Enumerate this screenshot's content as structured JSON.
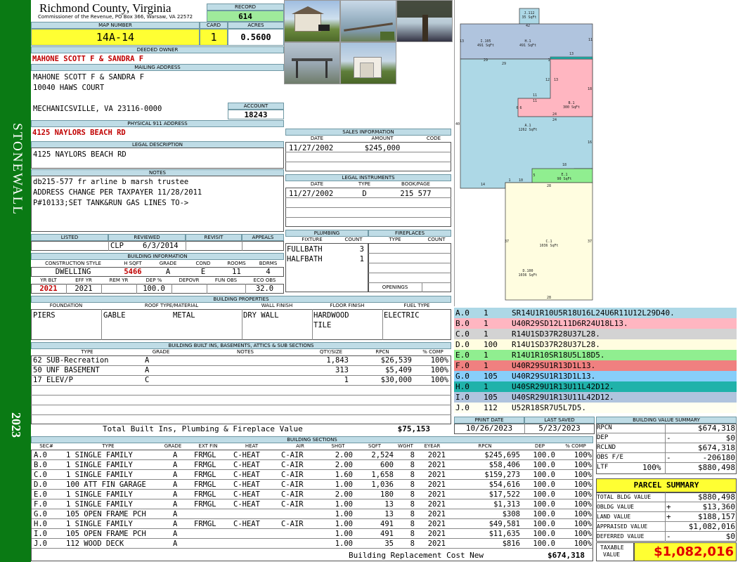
{
  "district": "STONEWALL",
  "year": "2023",
  "header": {
    "county": "Richmond County, Virginia",
    "commissioner": "Commissioner of the Revenue, PO Box 366, Warsaw, VA 22572",
    "record_label": "RECORD",
    "record": "614",
    "map_number_label": "MAP NUMBER",
    "map_number": "14A-14",
    "card_label": "CARD",
    "card": "1",
    "acres_label": "ACRES",
    "acres": "0.5600"
  },
  "owner": {
    "deeded_label": "DEEDED OWNER",
    "deeded_owner": "MAHONE SCOTT F & SANDRA F",
    "mailing_label": "MAILING ADDRESS",
    "mailing_line1": "MAHONE SCOTT F & SANDRA F",
    "mailing_line2": "10040 HAWS COURT",
    "mailing_line3": "MECHANICSVILLE, VA 23116-0000",
    "account_label": "ACCOUNT",
    "account": "18243",
    "physical_label": "PHYSICAL 911 ADDRESS",
    "physical_address": "4125 NAYLORS BEACH RD",
    "legal_label": "LEGAL DESCRIPTION",
    "legal_description": "4125 NAYLORS BEACH RD",
    "notes_label": "NOTES",
    "notes": [
      "db215-577 fr arline b marsh trustee",
      "ADDRESS CHANGE PER TAXPAYER 11/28/2011",
      "P#10133;SET TANK&RUN GAS LINES TO->"
    ]
  },
  "review": {
    "listed_label": "LISTED",
    "reviewed_label": "REVIEWED",
    "revisit_label": "REVISIT",
    "appeals_label": "APPEALS",
    "listed": "",
    "reviewed_by": "CLP",
    "reviewed_date": "6/3/2014",
    "revisit": "",
    "appeals": ""
  },
  "building_info": {
    "title": "BUILDING INFORMATION",
    "labels": [
      "CONSTRUCTION STYLE",
      "H SQFT",
      "GRADE",
      "COND",
      "ROOMS",
      "BDRMS"
    ],
    "style": "DWELLING",
    "hsqft": "5466",
    "grade": "A",
    "cond": "E",
    "rooms": "11",
    "bdrms": "4",
    "labels2": [
      "YR BLT",
      "EFF YR",
      "REM YR",
      "DEP %",
      "DEPOVR",
      "FUN OBS",
      "ECO OBS"
    ],
    "yr_blt": "2021",
    "eff_yr": "2021",
    "rem_yr": "",
    "dep_pct": "100.0",
    "depovr": "",
    "fun_obs": "",
    "eco_obs": "32.0"
  },
  "sales": {
    "title": "SALES INFORMATION",
    "headers": [
      "DATE",
      "AMOUNT",
      "CODE"
    ],
    "rows": [
      {
        "date": "11/27/2002",
        "amount": "$245,000",
        "code": ""
      }
    ]
  },
  "legal_instruments": {
    "title": "LEGAL INSTRUMENTS",
    "headers": [
      "DATE",
      "TYPE",
      "BOOK/PAGE"
    ],
    "rows": [
      {
        "date": "11/27/2002",
        "type": "D",
        "bookpage": "215 577"
      }
    ]
  },
  "plumbing": {
    "title": "PLUMBING",
    "headers": [
      "FIXTURE",
      "COUNT"
    ],
    "rows": [
      {
        "fixture": "FULLBATH",
        "count": "3"
      },
      {
        "fixture": "HALFBATH",
        "count": "1"
      }
    ]
  },
  "fireplaces": {
    "title": "FIREPLACES",
    "headers": [
      "TYPE",
      "COUNT"
    ],
    "openings_label": "OPENINGS"
  },
  "properties": {
    "title": "BUILDING PROPERTIES",
    "headers": [
      "FOUNDATION",
      "ROOF TYPE/MATERIAL",
      "WALL FINISH",
      "FLOOR FINISH",
      "FUEL TYPE"
    ],
    "foundation": "PIERS",
    "roof_type": "GABLE",
    "roof_material": "METAL",
    "wall_finish": "DRY WALL",
    "floor_finish_1": "HARDWOOD",
    "floor_finish_2": "TILE",
    "fuel_type": "ELECTRIC"
  },
  "built_ins": {
    "title": "BUILDING BUILT INS, BASEMENTS, ATTICS & SUB SECTIONS",
    "headers": [
      "TYPE",
      "GRADE",
      "NOTES",
      "QTY/SIZE",
      "RPCN",
      "% COMP"
    ],
    "rows": [
      {
        "type": "62 SUB-Recreation",
        "grade": "A",
        "notes": "",
        "qty": "1,843",
        "rpcn": "$26,539",
        "comp": "100%"
      },
      {
        "type": "50 UNF BASEMENT",
        "grade": "A",
        "notes": "",
        "qty": "313",
        "rpcn": "$5,409",
        "comp": "100%"
      },
      {
        "type": "17 ELEV/P",
        "grade": "C",
        "notes": "",
        "qty": "1",
        "rpcn": "$30,000",
        "comp": "100%"
      }
    ],
    "total_label": "Total Built Ins, Plumbing & Fireplace Value",
    "total": "$75,153"
  },
  "print": {
    "print_label": "PRINT DATE",
    "print_date": "10/26/2023",
    "saved_label": "LAST SAVED",
    "last_saved": "5/23/2023"
  },
  "sections": {
    "title": "BUILDING SECTIONS",
    "headers": [
      "SEC#",
      "TYPE",
      "GRADE",
      "EXT FIN",
      "HEAT",
      "AIR",
      "SHGT",
      "SQFT",
      "WGHT",
      "EYEAR",
      "RPCN",
      "DEP",
      "% COMP"
    ],
    "rows": [
      {
        "sec": "A.0",
        "type": "1 SINGLE FAMILY",
        "grade": "A",
        "ext": "FRMGL",
        "heat": "C-HEAT",
        "air": "C-AIR",
        "shgt": "2.00",
        "sqft": "2,524",
        "wght": "8",
        "eyear": "2021",
        "rpcn": "$245,695",
        "dep": "100.0",
        "comp": "100%"
      },
      {
        "sec": "B.0",
        "type": "1 SINGLE FAMILY",
        "grade": "A",
        "ext": "FRMGL",
        "heat": "C-HEAT",
        "air": "C-AIR",
        "shgt": "2.00",
        "sqft": "600",
        "wght": "8",
        "eyear": "2021",
        "rpcn": "$58,406",
        "dep": "100.0",
        "comp": "100%"
      },
      {
        "sec": "C.0",
        "type": "1 SINGLE FAMILY",
        "grade": "A",
        "ext": "FRMGL",
        "heat": "C-HEAT",
        "air": "C-AIR",
        "shgt": "1.60",
        "sqft": "1,658",
        "wght": "8",
        "eyear": "2021",
        "rpcn": "$159,273",
        "dep": "100.0",
        "comp": "100%"
      },
      {
        "sec": "D.0",
        "type": "100 ATT FIN GARAGE",
        "grade": "A",
        "ext": "FRMGL",
        "heat": "C-HEAT",
        "air": "C-AIR",
        "shgt": "1.00",
        "sqft": "1,036",
        "wght": "8",
        "eyear": "2021",
        "rpcn": "$54,616",
        "dep": "100.0",
        "comp": "100%"
      },
      {
        "sec": "E.0",
        "type": "1 SINGLE FAMILY",
        "grade": "A",
        "ext": "FRMGL",
        "heat": "C-HEAT",
        "air": "C-AIR",
        "shgt": "2.00",
        "sqft": "180",
        "wght": "8",
        "eyear": "2021",
        "rpcn": "$17,522",
        "dep": "100.0",
        "comp": "100%"
      },
      {
        "sec": "F.0",
        "type": "1 SINGLE FAMILY",
        "grade": "A",
        "ext": "FRMGL",
        "heat": "C-HEAT",
        "air": "C-AIR",
        "shgt": "1.00",
        "sqft": "13",
        "wght": "8",
        "eyear": "2021",
        "rpcn": "$1,313",
        "dep": "100.0",
        "comp": "100%"
      },
      {
        "sec": "G.0",
        "type": "105 OPEN FRAME PCH",
        "grade": "A",
        "ext": "",
        "heat": "",
        "air": "",
        "shgt": "1.00",
        "sqft": "13",
        "wght": "8",
        "eyear": "2021",
        "rpcn": "$308",
        "dep": "100.0",
        "comp": "100%"
      },
      {
        "sec": "H.0",
        "type": "1 SINGLE FAMILY",
        "grade": "A",
        "ext": "FRMGL",
        "heat": "C-HEAT",
        "air": "C-AIR",
        "shgt": "1.00",
        "sqft": "491",
        "wght": "8",
        "eyear": "2021",
        "rpcn": "$49,581",
        "dep": "100.0",
        "comp": "100%"
      },
      {
        "sec": "I.0",
        "type": "105 OPEN FRAME PCH",
        "grade": "A",
        "ext": "",
        "heat": "",
        "air": "",
        "shgt": "1.00",
        "sqft": "491",
        "wght": "8",
        "eyear": "2021",
        "rpcn": "$11,635",
        "dep": "100.0",
        "comp": "100%"
      },
      {
        "sec": "J.0",
        "type": "112 WOOD DECK",
        "grade": "A",
        "ext": "",
        "heat": "",
        "air": "",
        "shgt": "1.00",
        "sqft": "35",
        "wght": "8",
        "eyear": "2021",
        "rpcn": "$816",
        "dep": "100.0",
        "comp": "100%"
      }
    ],
    "total_label": "Building Replacement Cost New",
    "total": "$674,318"
  },
  "segments": [
    {
      "letter": "A.0",
      "count": "1",
      "desc": "SR14U1R10U5R18U16L24U6R11U12L29D40.",
      "color": "#add8e6"
    },
    {
      "letter": "B.0",
      "count": "1",
      "desc": "U40R29SD12L11D6R24U18L13.",
      "color": "#ffb6c1"
    },
    {
      "letter": "C.0",
      "count": "1",
      "desc": "R14U1SD37R28U37L28.",
      "color": "#d3d3d3"
    },
    {
      "letter": "D.0",
      "count": "100",
      "desc": "R14U1SD37R28U37L28.",
      "color": "#fffde0"
    },
    {
      "letter": "E.0",
      "count": "1",
      "desc": "R14U1R10SR18U5L18D5.",
      "color": "#90ee90"
    },
    {
      "letter": "F.0",
      "count": "1",
      "desc": "U40R29SU1R13D1L13.",
      "color": "#f08080"
    },
    {
      "letter": "G.0",
      "count": "105",
      "desc": "U40R29SU1R13D1L13.",
      "color": "#87cefa"
    },
    {
      "letter": "H.0",
      "count": "1",
      "desc": "U40SR29U1R13U11L42D12.",
      "color": "#20b2aa"
    },
    {
      "letter": "I.0",
      "count": "105",
      "desc": "U40SR29U1R13U11L42D12.",
      "color": "#b0c4de"
    },
    {
      "letter": "J.0",
      "count": "112",
      "desc": "U52R18SR7U5L7D5.",
      "color": "#fffff0"
    }
  ],
  "sketch": {
    "labels": [
      {
        "id": "J.112",
        "area": "35 SqFt"
      },
      {
        "id": "I.105",
        "area": "491 SqFt"
      },
      {
        "id": "H.1",
        "area": "491 SqFt"
      },
      {
        "id": "B.1",
        "area": "300 SqFt"
      },
      {
        "id": "A.1",
        "area": "1262 SqFt"
      },
      {
        "id": "E.1",
        "area": "90 SqFt"
      },
      {
        "id": "C.1",
        "area": "1036 SqFt"
      },
      {
        "id": "D.100",
        "area": "1036 SqFt"
      }
    ],
    "dims": [
      "42",
      "13",
      "11",
      "29",
      "29",
      "1",
      "13",
      "12",
      "13",
      "18",
      "11",
      "11",
      "6",
      "6",
      "24",
      "24",
      "40",
      "16",
      "18",
      "5",
      "14",
      "1",
      "10",
      "28",
      "37",
      "37",
      "28"
    ]
  },
  "value_summary": {
    "title": "BUILDING VALUE SUMMARY",
    "rpcn_label": "RPCN",
    "rpcn": "$674,318",
    "dep_label": "DEP",
    "dep_sign": "-",
    "dep": "$0",
    "rclnd_label": "RCLND",
    "rclnd": "$674,318",
    "obs_label": "OBS F/E",
    "obs_sign": "-",
    "obs": "-206180",
    "ltf_label": "LTF",
    "ltf_pct": "100%",
    "ltf": "$880,498"
  },
  "parcel_summary": {
    "title": "PARCEL SUMMARY",
    "total_bldg_label": "TOTAL BLDG VALUE",
    "total_bldg": "$880,498",
    "obldg_label": "OBLDG VALUE",
    "obldg_sign": "+",
    "obldg": "$13,360",
    "land_label": "LAND VALUE",
    "land_sign": "+",
    "land": "$188,157",
    "appraised_label": "APPRAISED VALUE",
    "appraised": "$1,082,016",
    "deferred_label": "DEFERRED VALUE",
    "deferred_sign": "-",
    "deferred": "$0",
    "taxable_label1": "TAXABLE",
    "taxable_label2": "VALUE",
    "taxable": "$1,082,016"
  }
}
